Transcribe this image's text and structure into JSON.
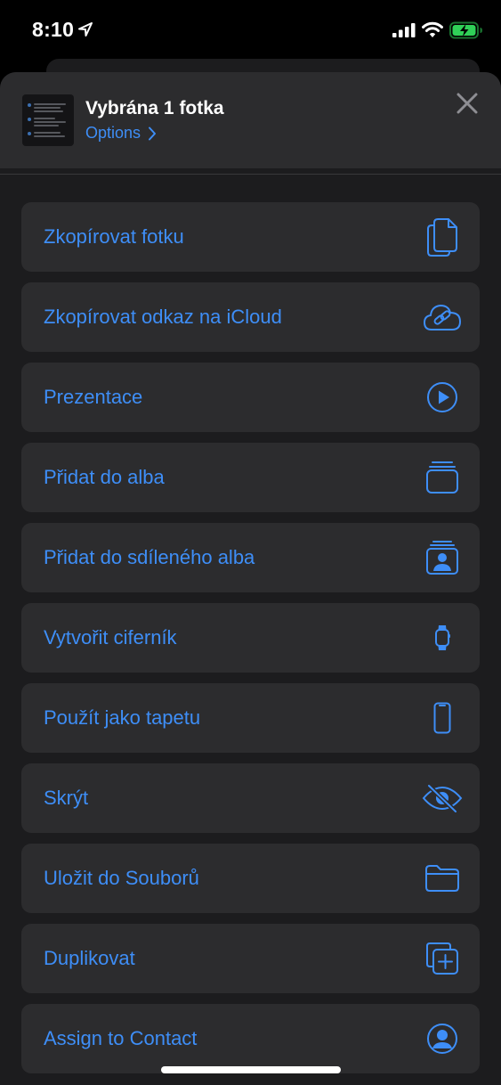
{
  "status_bar": {
    "time": "8:10"
  },
  "header": {
    "title": "Vybrána 1 fotka",
    "options_label": "Options"
  },
  "actions": [
    {
      "label": "Zkopírovat fotku",
      "icon": "copy-document-icon"
    },
    {
      "label": "Zkopírovat odkaz na iCloud",
      "icon": "icloud-link-icon"
    },
    {
      "label": "Prezentace",
      "icon": "play-circle-icon"
    },
    {
      "label": "Přidat do alba",
      "icon": "album-stack-icon"
    },
    {
      "label": "Přidat do sdíleného alba",
      "icon": "shared-album-icon"
    },
    {
      "label": "Vytvořit ciferník",
      "icon": "apple-watch-icon"
    },
    {
      "label": "Použít jako tapetu",
      "icon": "iphone-icon"
    },
    {
      "label": "Skrýt",
      "icon": "eye-slash-icon"
    },
    {
      "label": "Uložit do Souborů",
      "icon": "folder-icon"
    },
    {
      "label": "Duplikovat",
      "icon": "duplicate-plus-icon"
    },
    {
      "label": "Assign to Contact",
      "icon": "person-circle-icon"
    }
  ],
  "colors": {
    "accent": "#3e8ef7",
    "row_background": "#2c2c2e",
    "sheet_background": "#1c1c1e",
    "battery_charging": "#30d158"
  }
}
